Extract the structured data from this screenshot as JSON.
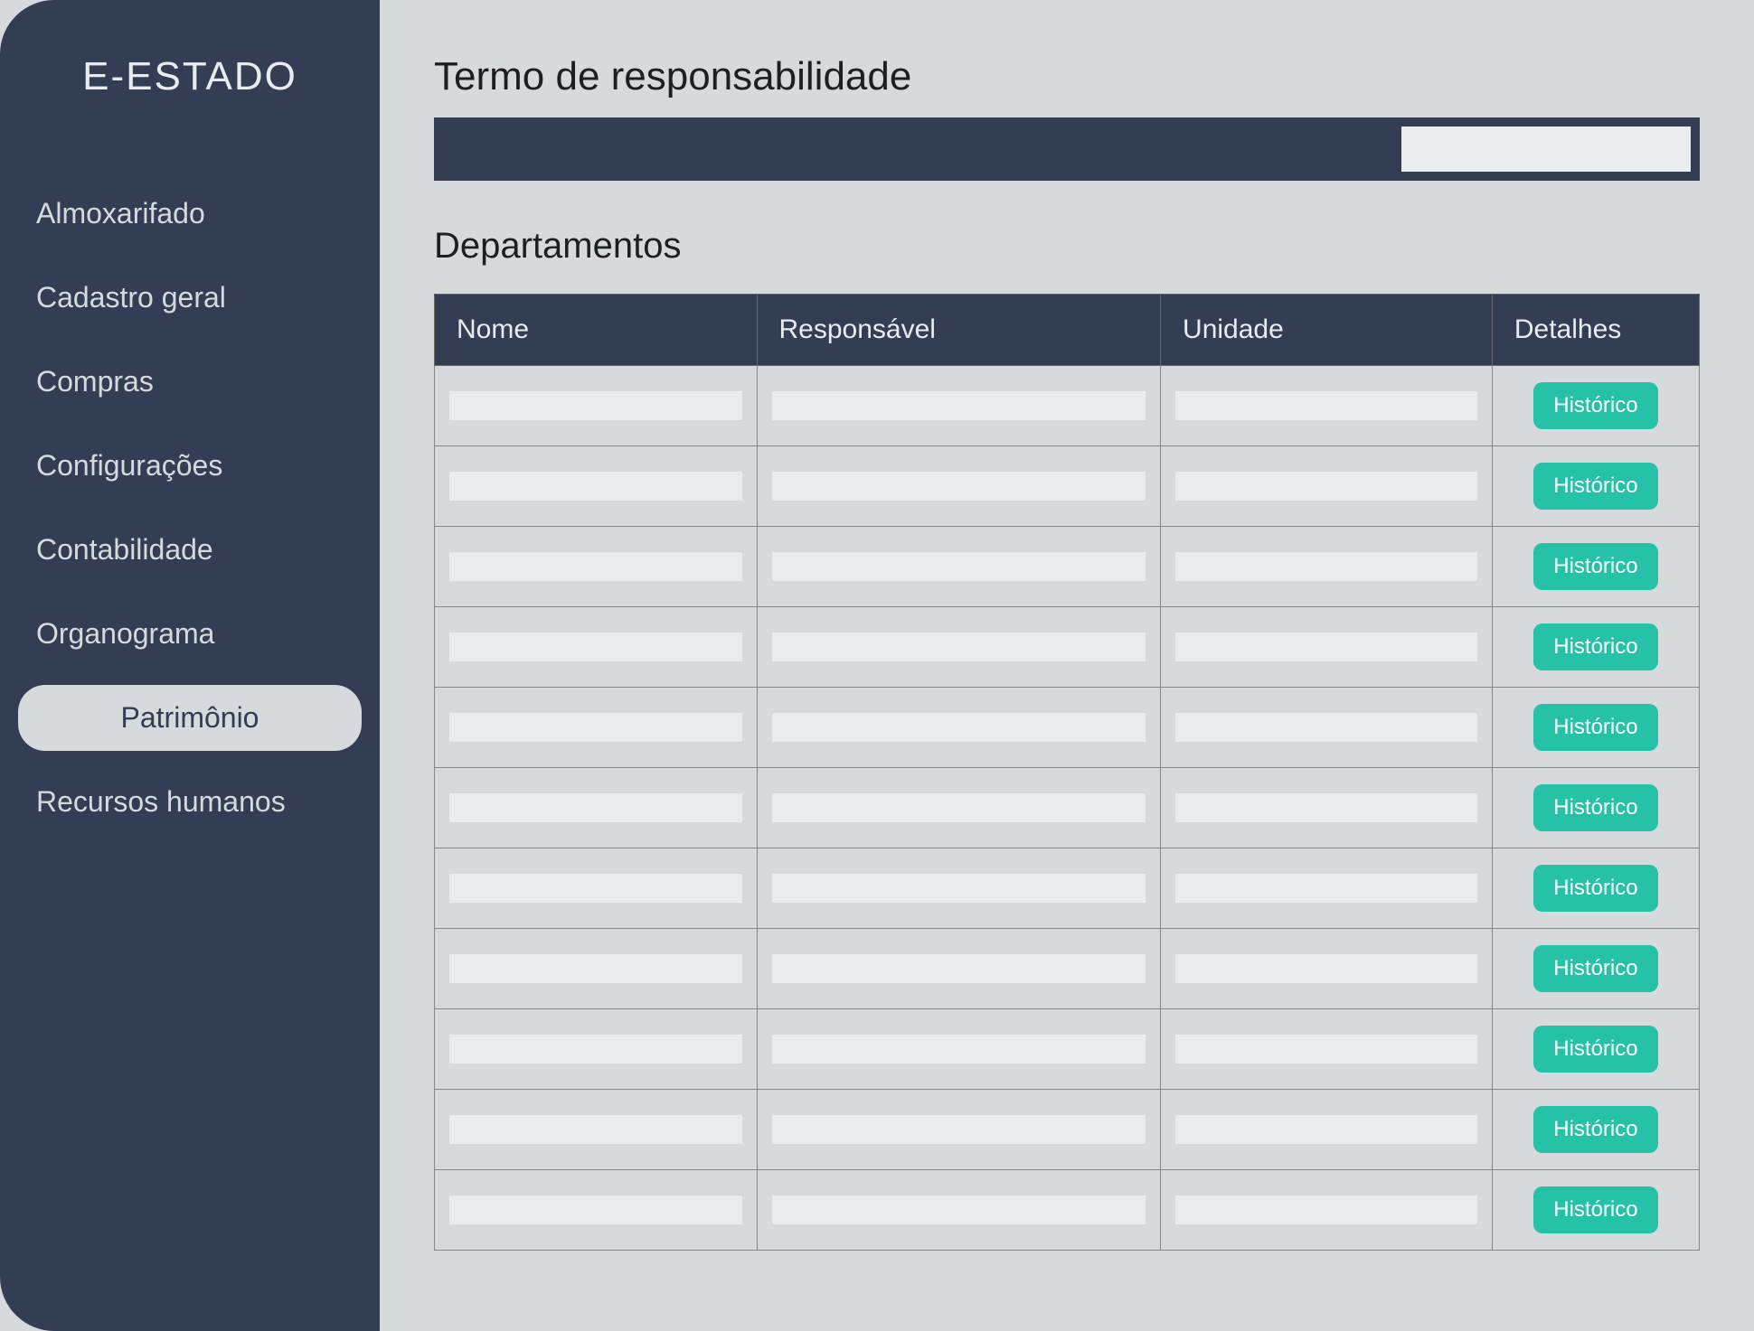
{
  "sidebar": {
    "title": "E-ESTADO",
    "items": [
      {
        "label": "Almoxarifado",
        "active": false
      },
      {
        "label": "Cadastro geral",
        "active": false
      },
      {
        "label": "Compras",
        "active": false
      },
      {
        "label": "Configurações",
        "active": false
      },
      {
        "label": "Contabilidade",
        "active": false
      },
      {
        "label": "Organograma",
        "active": false
      },
      {
        "label": "Patrimônio",
        "active": true
      },
      {
        "label": "Recursos humanos",
        "active": false
      }
    ]
  },
  "main": {
    "page_title": "Termo de responsabilidade",
    "search_value": "",
    "section_title": "Departamentos",
    "table": {
      "headers": {
        "nome": "Nome",
        "responsavel": "Responsável",
        "unidade": "Unidade",
        "detalhes": "Detalhes"
      },
      "action_label": "Histórico",
      "rows": [
        {
          "nome": "",
          "responsavel": "",
          "unidade": ""
        },
        {
          "nome": "",
          "responsavel": "",
          "unidade": ""
        },
        {
          "nome": "",
          "responsavel": "",
          "unidade": ""
        },
        {
          "nome": "",
          "responsavel": "",
          "unidade": ""
        },
        {
          "nome": "",
          "responsavel": "",
          "unidade": ""
        },
        {
          "nome": "",
          "responsavel": "",
          "unidade": ""
        },
        {
          "nome": "",
          "responsavel": "",
          "unidade": ""
        },
        {
          "nome": "",
          "responsavel": "",
          "unidade": ""
        },
        {
          "nome": "",
          "responsavel": "",
          "unidade": ""
        },
        {
          "nome": "",
          "responsavel": "",
          "unidade": ""
        },
        {
          "nome": "",
          "responsavel": "",
          "unidade": ""
        }
      ]
    }
  },
  "colors": {
    "sidebar_bg": "#333d54",
    "page_bg": "#d7dadd",
    "accent": "#26c2a7",
    "cell_fill": "#e8ecef"
  }
}
